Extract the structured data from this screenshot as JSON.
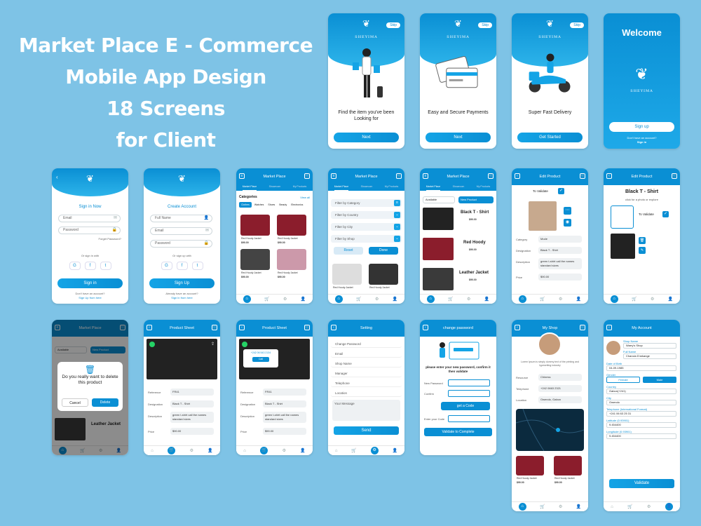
{
  "headline": {
    "line1": "Market Place E - Commerce",
    "line2": "Mobile App Design",
    "line3": "18 Screens",
    "line4": "for Client"
  },
  "brand": {
    "logo_text": "SHEYIMA"
  },
  "common": {
    "skip": "Skip",
    "next": "Next"
  },
  "onboarding": [
    {
      "title": "Find the item you've been Looking for"
    },
    {
      "title": "Easy and Secure Payments"
    },
    {
      "title": "Super Fast Delivery",
      "button": "Get Started"
    }
  ],
  "welcome": {
    "title": "Welcome",
    "signup": "Sign up",
    "question": "Don't have an account?",
    "signin": "Sign in"
  },
  "signin": {
    "title": "Sign in Now",
    "email": "Email",
    "password": "Password",
    "forgot": "Forget Password?",
    "or": "Or sign in with",
    "button": "Sign in",
    "question": "Don't have an account?",
    "link": "Sign Up from here"
  },
  "signup": {
    "title": "Create Account",
    "fullname": "Full Name",
    "email": "Email",
    "password": "Password",
    "or": "Or sign up with",
    "button": "Sign Up",
    "question": "Already have an account?",
    "link": "Sign in from here"
  },
  "marketplace": {
    "title": "Market Place",
    "tabs": [
      "Market Place",
      "Showroom",
      "My Products"
    ],
    "categories": "Categories",
    "view_all": "View all",
    "chips": [
      "Clothes",
      "Watches",
      "Shoes",
      "Beauty",
      "Electronics"
    ],
    "item_name": "Red Hoody Jacket",
    "price": "$90.00"
  },
  "filter": {
    "items": [
      "Filter by Category",
      "Filter by Country",
      "Filter by City",
      "Filter by Shop"
    ],
    "reset": "Reset",
    "done": "Done"
  },
  "myproducts": {
    "available": "Available",
    "new_product": "New Product",
    "items": [
      {
        "name": "Black T - Shirt",
        "price": "$90.00"
      },
      {
        "name": "Red Hoody",
        "price": "$90.00"
      },
      {
        "name": "Leather Jacket",
        "price": "$90.00"
      }
    ]
  },
  "edit_product": {
    "title": "Edit Product",
    "validate": "To Validate",
    "labels": [
      "Category",
      "Designation",
      "Description",
      "Price"
    ],
    "values": [
      "Mode",
      "Black T - Shirt",
      "green t-shirt call the names standard sizes",
      "$90.00"
    ]
  },
  "edit_product2": {
    "title": "Edit Product",
    "name": "Black T - Shirt",
    "hint": "click for a photo or explore",
    "validate": "To Validate"
  },
  "delete_dialog": {
    "text": "Do you really want to delete this product",
    "cancel": "Cancel",
    "delete": "Delete",
    "bg_item": "Leather Jacket"
  },
  "product_sheet": {
    "title": "Product Sheet",
    "labels": [
      "Reference",
      "Designation",
      "Description",
      "Price"
    ],
    "values": [
      "FR41",
      "Black T - Shirt",
      "green t-shirt call the names standard sizes",
      "$90.00"
    ],
    "popup_phone": "+242 06 543 2134",
    "popup_btn": "Call"
  },
  "setting": {
    "title": "Setting",
    "items": [
      "Change Password",
      "Email",
      "Shop Name",
      "Manager",
      "Telephone",
      "Location"
    ],
    "message": "Your Message",
    "send": "Send"
  },
  "change_password": {
    "title": "change password",
    "instruction": "please enter your new password, confirm it then validate",
    "labels": [
      "New Password",
      "Confirm"
    ],
    "get_code": "get a Code",
    "code_label": "Enter your Code",
    "validate": "Validate to Complete"
  },
  "myshop": {
    "title": "My Shop",
    "desc": "Lorem Ipsum is simply dummy text of the printing and typesetting industry",
    "labels": [
      "Resource",
      "Telephone",
      "Location"
    ],
    "values": [
      "Chiness",
      "+242 0663 2321",
      "Owendo, Gabon"
    ],
    "item_name": "Red Hoody Jacket",
    "price": "$90.00"
  },
  "account": {
    "title": "My Account",
    "shop_label": "Shop Name",
    "shop": "Warry's Shop",
    "full_label": "Full Name",
    "full": "Chancia D'arkange",
    "dob_label": "Date of Birth",
    "dob": "04-09-1985",
    "gender_label": "Gender",
    "female": "Female",
    "male": "Male",
    "country_label": "Country",
    "country": "Gabon(+241)",
    "city_label": "City",
    "city": "Owendo",
    "phone_label": "Telephone (International Format)",
    "phone": "+241 06 63 25 31",
    "lat_label": "Latitude (0.93901)",
    "lat": "9.454400",
    "lon_label": "Longitude (0.93901)",
    "lon": "9.454400",
    "button": "Validate"
  },
  "colors": {
    "primary": "#0a8fd4",
    "background": "#7ec3e6",
    "product_red": "#8b1d2c"
  }
}
